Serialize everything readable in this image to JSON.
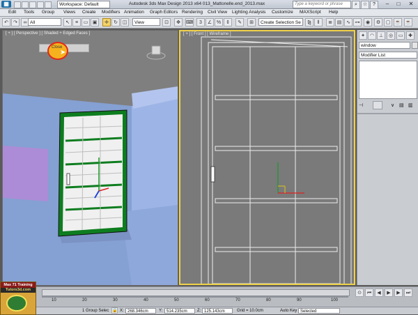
{
  "app": {
    "title": "Autodesk 3ds Max Design 2013 x64     013_Mattonelle.end_2013.max",
    "workspace": "Workspace: Default",
    "search_placeholder": "Type a keyword or phrase"
  },
  "menu": [
    "Edit",
    "Tools",
    "Group",
    "Views",
    "Create",
    "Modifiers",
    "Animation",
    "Graph Editors",
    "Rendering",
    "Civil View",
    "Lighting Analysis",
    "Customize",
    "MAXScript",
    "Help"
  ],
  "toolbar": {
    "filter": "All",
    "ref_coord": "View",
    "selection_set": "Create Selection Se"
  },
  "viewports": {
    "left": {
      "label": "[ + ] [ Perspective ] [ Shaded + Edged Faces ]",
      "tooltip": "Close"
    },
    "right": {
      "label": "[ + ] [ Front ] [ Wireframe ]"
    }
  },
  "command_panel": {
    "object_name": "window",
    "modifier_list": "Modifier List"
  },
  "timeline": {
    "ticks": [
      "10",
      "20",
      "30",
      "40",
      "50",
      "60",
      "70",
      "80",
      "90",
      "100"
    ]
  },
  "status": {
    "selected": "1 Group Selec",
    "x_value": "268.346cm",
    "y_value": "514.235cm",
    "z_value": "125.143cm",
    "grid": "Grid = 10.0cm",
    "autokey_label": "Auto Key",
    "autokey_value": "Selected",
    "x_label": "X:",
    "y_label": "Y:",
    "z_label": "Z:"
  },
  "watermark": {
    "line1": "Max 71 Training",
    "line2": "Tutors3d.com"
  },
  "colors": {
    "accent": "#f0d24a",
    "selection_green": "#1a9a2a",
    "wall_blue": "#9cb6e8",
    "tooltip_ring": "#e0291b"
  }
}
